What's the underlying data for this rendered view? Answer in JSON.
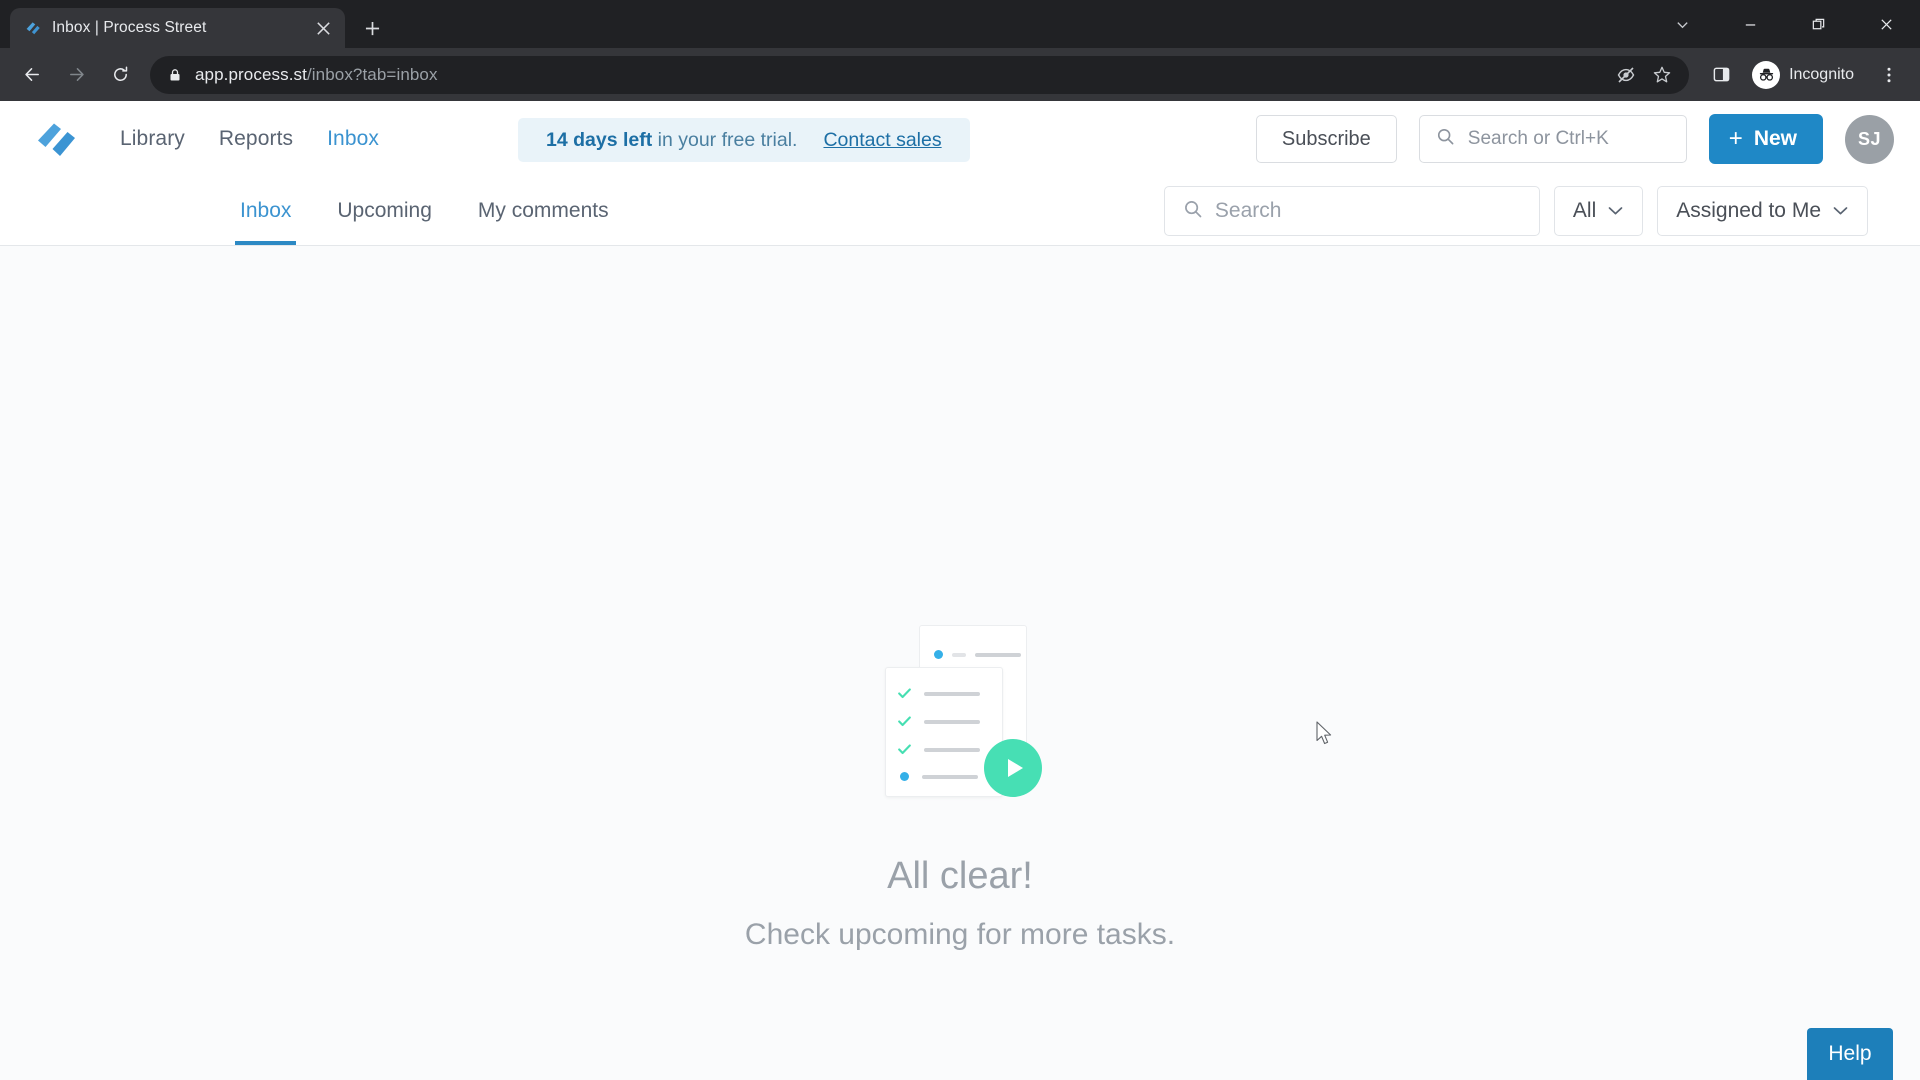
{
  "browser": {
    "tab": {
      "title": "Inbox | Process Street",
      "favicon_icon": "process-street-favicon",
      "close_icon": "close-icon"
    },
    "new_tab_icon": "plus-icon",
    "window_controls": [
      {
        "name": "tab-search",
        "icon": "chevron-down-icon"
      },
      {
        "name": "minimize",
        "icon": "minimize-icon"
      },
      {
        "name": "restore",
        "icon": "restore-icon"
      },
      {
        "name": "close",
        "icon": "close-icon"
      }
    ],
    "nav": {
      "back_icon": "back-arrow-icon",
      "forward_icon": "forward-arrow-icon",
      "reload_icon": "reload-icon"
    },
    "omnibox": {
      "lock_icon": "lock-icon",
      "url_host": "app.process.st",
      "url_path": "/inbox?tab=inbox",
      "tracking_icon": "eye-slash-icon",
      "bookmark_icon": "star-icon"
    },
    "side_panel_icon": "side-panel-icon",
    "incognito": {
      "label": "Incognito",
      "icon": "incognito-icon"
    },
    "menu_icon": "kebab-menu-icon"
  },
  "app": {
    "logo_icon": "process-street-logo",
    "main_nav": [
      {
        "label": "Library",
        "active": false
      },
      {
        "label": "Reports",
        "active": false
      },
      {
        "label": "Inbox",
        "active": true
      }
    ],
    "trial_banner": {
      "bold_text": "14 days left",
      "rest_text": " in your free trial.",
      "link_label": "Contact sales"
    },
    "subscribe_label": "Subscribe",
    "header_search": {
      "placeholder": "Search or Ctrl+K",
      "value": "",
      "icon": "search-icon"
    },
    "new_button": {
      "label": "New",
      "plus": "+"
    },
    "avatar_initials": "SJ",
    "subnav": {
      "tabs": [
        {
          "label": "Inbox",
          "active": true
        },
        {
          "label": "Upcoming",
          "active": false
        },
        {
          "label": "My comments",
          "active": false
        }
      ],
      "search": {
        "placeholder": "Search",
        "value": "",
        "icon": "search-icon"
      },
      "filters": [
        {
          "label": "All",
          "icon": "chevron-down-icon"
        },
        {
          "label": "Assigned to Me",
          "icon": "chevron-down-icon"
        }
      ]
    },
    "empty_state": {
      "illustration_icon": "checklist-play-illustration",
      "title": "All clear!",
      "subtitle": "Check upcoming for more tasks."
    },
    "help_label": "Help"
  },
  "colors": {
    "brand_blue": "#1f88c6",
    "accent_blue": "#3b93d0",
    "trial_bg": "#e9f3f9",
    "green": "#47dfb4",
    "page_bg": "#fafbfc",
    "chrome_dark": "#202124"
  }
}
